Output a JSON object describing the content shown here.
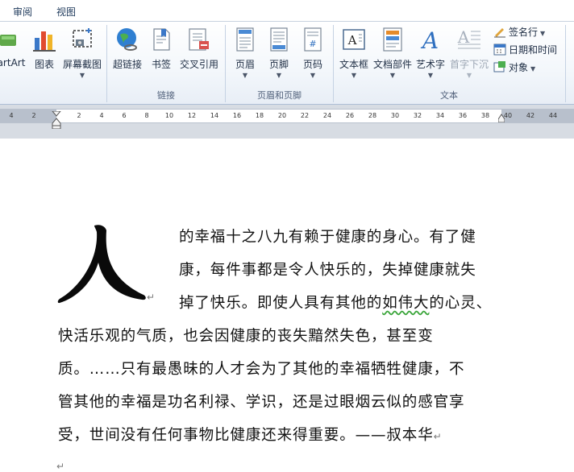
{
  "menu_tabs": [
    "审阅",
    "视图"
  ],
  "ribbon": {
    "buttons": {
      "smartart": "artArt",
      "chart": "图表",
      "screenshot": "屏幕截图",
      "hyperlink": "超链接",
      "bookmark": "书签",
      "cross_reference": "交叉引用",
      "header": "页眉",
      "footer": "页脚",
      "page_number": "页码",
      "text_box": "文本框",
      "quick_parts": "文档部件",
      "wordart": "艺术字",
      "drop_cap": "首字下沉",
      "signature_line": "签名行",
      "date_time": "日期和时间",
      "object": "对象"
    },
    "groups": {
      "links": "链接",
      "header_footer": "页眉和页脚",
      "text": "文本"
    }
  },
  "ruler": {
    "ticks": [
      "4",
      "2",
      "2",
      "4",
      "6",
      "8",
      "10",
      "12",
      "14",
      "16",
      "18",
      "20",
      "22",
      "24",
      "26",
      "28",
      "30",
      "32",
      "34",
      "36",
      "38",
      "40",
      "42",
      "44"
    ]
  },
  "document": {
    "drop_cap": "人",
    "lines": {
      "l1": "的幸福十之八九有赖于健康的身心。有了健",
      "l2": "康，每件事都是令人快乐的，失掉健康就失",
      "l3a": "掉了快乐。即使人具有其他的",
      "l3b": "如伟大",
      "l3c": "的心灵、",
      "l4": "快活乐观的气质，也会因健康的丧失黯然失色，甚至变",
      "l5": "质。……只有最愚昧的人才会为了其他的幸福牺牲健康，不",
      "l6": "管其他的幸福是功名利禄、学识，还是过眼烟云似的感官享",
      "l7": "受，世间没有任何事物比健康还来得重要。——叔本华"
    },
    "paragraph_mark": "↵"
  }
}
